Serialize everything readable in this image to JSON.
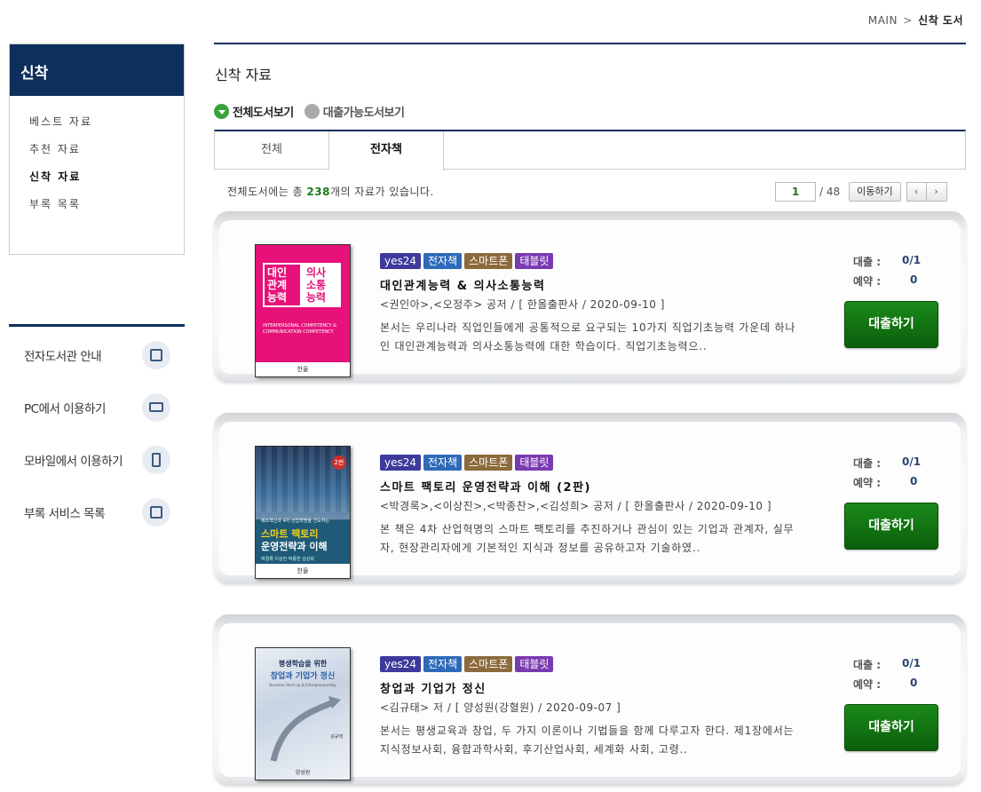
{
  "breadcrumb": {
    "home": "MAIN",
    "sep": ">",
    "current": "신착 도서"
  },
  "sidebar": {
    "title": "신착",
    "menu": [
      {
        "label": "베스트 자료",
        "active": false
      },
      {
        "label": "추천 자료",
        "active": false
      },
      {
        "label": "신착 자료",
        "active": true
      },
      {
        "label": "부록 목록",
        "active": false
      }
    ],
    "guide": [
      {
        "label": "전자도서관 안내",
        "icon": "book-guide-icon"
      },
      {
        "label": "PC에서 이용하기",
        "icon": "monitor-icon"
      },
      {
        "label": "모바일에서 이용하기",
        "icon": "mobile-icon"
      },
      {
        "label": "부록 서비스 목록",
        "icon": "list-icon"
      }
    ]
  },
  "main": {
    "title": "신착 자료",
    "filters": [
      {
        "label": "전체도서보기",
        "selected": true
      },
      {
        "label": "대출가능도서보기",
        "selected": false
      }
    ],
    "tabs": [
      {
        "label": "전체",
        "active": false
      },
      {
        "label": "전자책",
        "active": true
      }
    ],
    "count": {
      "prefix": "전체도서에는 총 ",
      "value": "238",
      "suffix": "개의 자료가 있습니다."
    },
    "pager": {
      "current": "1",
      "total": "/ 48",
      "move_label": "이동하기",
      "prev": "‹",
      "next": "›"
    }
  },
  "labels": {
    "loan": "대출 :",
    "reserve": "예약 :",
    "loan_button": "대출하기"
  },
  "books": [
    {
      "badges": [
        "yes24",
        "전자책",
        "스마트폰",
        "태블릿"
      ],
      "title": "대인관계능력 & 의사소통능력",
      "meta": "<권인아>,<오정주> 공저 / [ 한올출판사 / 2020-09-10 ]",
      "desc": "본서는 우리나라 직업인들에게 공통적으로 요구되는 10가지 직업기초능력 가운데 하나인 대인관계능력과 의사소통능력에 대한 학습이다. 직업기초능력으..",
      "loan": "0/1",
      "reserve": "0",
      "cover": {
        "line1": "대인",
        "line2": "관계",
        "line3": "능력",
        "right1": "의사",
        "right2": "소통",
        "right3": "능력",
        "en": "INTERPERSONAL COMPETENCY & COMMUNICATION COMPETENCY",
        "publisher": "한올"
      }
    },
    {
      "badges": [
        "yes24",
        "전자책",
        "스마트폰",
        "태블릿"
      ],
      "title": "스마트 팩토리 운영전략과 이해 (2판)",
      "meta": "<박경록>,<이상진>,<박종찬>,<김성희> 공저 / [ 한올출판사 / 2020-09-10 ]",
      "desc": "본 책은 4차 산업혁명의 스마트 팩토리를 추진하거나 관심이 있는 기업과 관계자, 실무자, 현장관리자에게 기본적인 지식과 정보를 공유하고자 기술하였..",
      "loan": "0/1",
      "reserve": "0",
      "cover": {
        "edition": "2판",
        "sub": "제조혁신과 4차 산업혁명을 선도하는",
        "main1": "스마트 팩토리",
        "main2": "운영전략과 이해",
        "authors": "박경록 이상진 박종찬 김성희",
        "publisher": "한올"
      }
    },
    {
      "badges": [
        "yes24",
        "전자책",
        "스마트폰",
        "태블릿"
      ],
      "title": "창업과 기업가 정신",
      "meta": "<김규태> 저 / [ 양성원(강혈원) / 2020-09-07 ]",
      "desc": "본서는 평생교육과 창업, 두 가지 이론이나 기법들을 함께 다루고자 한다. 제1장에서는 지식정보사회, 융합과학사회, 후기산업사회, 세계화 사회, 고령..",
      "loan": "0/1",
      "reserve": "0",
      "cover": {
        "top": "평생학습을 위한",
        "main": "창업과 기업가 정신",
        "en": "Business Start-up & Entrepreneurship",
        "author": "김규태",
        "publisher": "양성원"
      }
    }
  ]
}
